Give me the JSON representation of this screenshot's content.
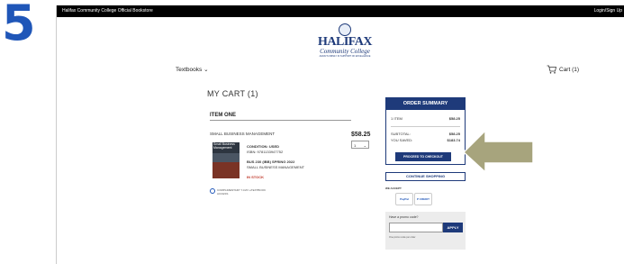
{
  "step": {
    "number": "5"
  },
  "topbar": {
    "store_name": "Halifax Community College Official Bookstore",
    "login": "Login/Sign Up"
  },
  "logo": {
    "name": "HALIFAX",
    "sub": "Community College",
    "tagline": "ALWAYS FIRMLY IN SUPPORT OF EXCELLENCE"
  },
  "nav": {
    "textbooks": "Textbooks",
    "cart": "Cart (1)"
  },
  "cart": {
    "title": "MY CART (1)",
    "item_heading": "ITEM ONE",
    "item": {
      "name": "SMALL BUSINESS MANAGEMENT",
      "price": "$58.25",
      "qty": "1",
      "condition": "CONDITION: USED",
      "isbn": "ISBN: 9781133947752",
      "course": "BUS 230 (IBB) SPRING 2022",
      "course_title": "SMALL BUSINESS MANAGEMENT",
      "stock": "IN STOCK",
      "cover_text": "Small Business Management",
      "access_note": "COMPLIMENTARY 7-DAY eTEXTBOOK ACCESS"
    }
  },
  "summary": {
    "title": "ORDER SUMMARY",
    "rows": [
      {
        "label": "1 ITEM",
        "value": "$58.25"
      },
      {
        "label": "SUBTOTAL:",
        "value": "$58.25"
      },
      {
        "label": "YOU SAVED:",
        "value": "$183.74"
      }
    ],
    "checkout": "PROCEED TO CHECKOUT"
  },
  "continue_shopping": "CONTINUE SHOPPING",
  "we_accept": "WE ACCEPT",
  "payments": [
    "PayPal",
    "P CREDIT"
  ],
  "promo": {
    "label": "Have a promo code?",
    "apply": "APPLY",
    "note": "One promo code per order"
  },
  "colors": {
    "navy": "#1e3a7a",
    "arrow": "#a7a47d",
    "step_blue": "#1f56b8",
    "stock_red": "#c0392b"
  }
}
